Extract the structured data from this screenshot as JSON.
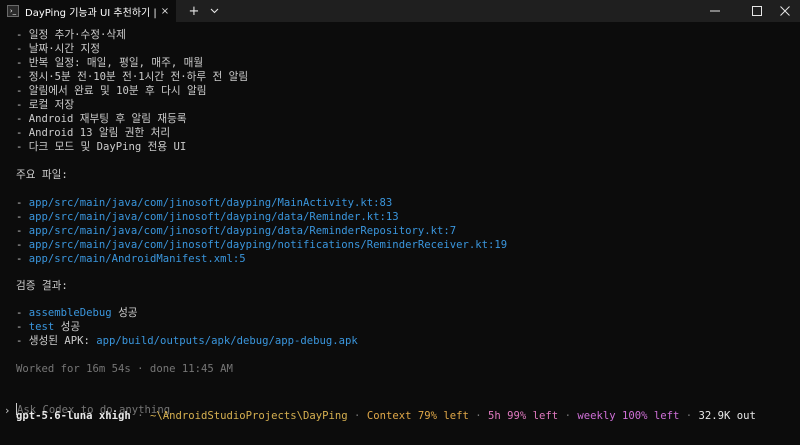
{
  "window": {
    "tab_title": "DayPing 기능과 UI 추천하기 |",
    "tab_icon": "terminal-icon",
    "close_glyph": "×",
    "newtab_glyph": "+",
    "dropdown_glyph": "⌄",
    "min_glyph": "—",
    "max_glyph": "☐",
    "close_win_glyph": "✕"
  },
  "features": [
    "- 일정 추가·수정·삭제",
    "- 날짜·시간 지정",
    "- 반복 일정: 매일, 평일, 매주, 매월",
    "- 정시·5분 전·10분 전·1시간 전·하루 전 알림",
    "- 알림에서 완료 및 10분 후 다시 알림",
    "- 로컬 저장",
    "- Android 재부팅 후 알림 재등록",
    "- Android 13 알림 권한 처리",
    "- 다크 모드 및 DayPing 전용 UI"
  ],
  "files_heading": "주요 파일:",
  "files": [
    "app/src/main/java/com/jinosoft/dayping/MainActivity.kt:83",
    "app/src/main/java/com/jinosoft/dayping/data/Reminder.kt:13",
    "app/src/main/java/com/jinosoft/dayping/data/ReminderRepository.kt:7",
    "app/src/main/java/com/jinosoft/dayping/notifications/ReminderReceiver.kt:19",
    "app/src/main/AndroidManifest.xml:5"
  ],
  "bullet": "- ",
  "verify_heading": "검증 결과:",
  "verify": [
    {
      "code": "assembleDebug",
      "text": " 성공"
    },
    {
      "code": "test",
      "text": " 성공"
    }
  ],
  "apk_label": "생성된 APK: ",
  "apk_path": "app/build/outputs/apk/debug/app-debug.apk",
  "worked": "Worked for 16m 54s · done 11:45 AM",
  "prompt": {
    "caret": "›",
    "placeholder": "Ask Codex to do anything"
  },
  "status": {
    "model": "gpt-5.6-luna xhigh",
    "sep": " · ",
    "path": "~\\AndroidStudioProjects\\DayPing",
    "context": "Context 79% left",
    "five_h": "5h 99% left",
    "weekly": "weekly 100% left",
    "out": "32.9K out"
  },
  "colors": {
    "background": "#0c0c0c",
    "path_blue": "#3a96dd",
    "dim": "#767676"
  }
}
